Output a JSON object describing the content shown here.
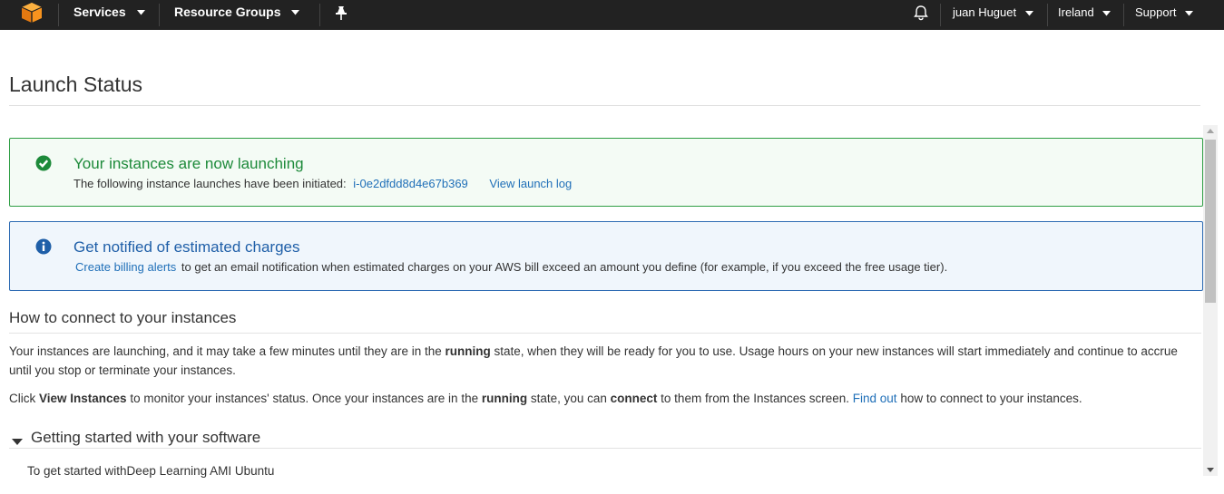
{
  "nav": {
    "services": "Services",
    "resource_groups": "Resource Groups",
    "user": "juan Huguet",
    "region": "Ireland",
    "support": "Support"
  },
  "page": {
    "title": "Launch Status"
  },
  "alerts": {
    "success": {
      "title": "Your instances are now launching",
      "text": "The following instance launches have been initiated:",
      "instance_id": "i-0e2dfdd8d4e67b369",
      "log_link": "View launch log"
    },
    "billing": {
      "title": "Get notified of estimated charges",
      "link": "Create billing alerts",
      "text": "to get an email notification when estimated charges on your AWS bill exceed an amount you define (for example, if you exceed the free usage tier)."
    }
  },
  "connect": {
    "title": "How to connect to your instances",
    "p1_a": "Your instances are launching, and it may take a few minutes until they are in the ",
    "p1_b": "running",
    "p1_c": " state, when they will be ready for you to use. Usage hours on your new instances will start immediately and continue to accrue until you stop or terminate your instances.",
    "p2_a": "Click ",
    "p2_b": "View Instances",
    "p2_c": " to monitor your instances' status. Once your instances are in the ",
    "p2_d": "running",
    "p2_e": " state, you can ",
    "p2_f": "connect",
    "p2_g": " to them from the Instances screen. ",
    "p2_link": "Find out",
    "p2_h": " how to connect to your instances."
  },
  "software": {
    "title": "Getting started with your software",
    "text": "To get started withDeep Learning AMI Ubuntu"
  },
  "colors": {
    "nav_bg": "#222222",
    "success": "#1d8a3a",
    "link": "#1f6fb8",
    "aws_orange": "#f7931e"
  },
  "icons": [
    "aws-cube-icon",
    "pin-icon",
    "bell-icon",
    "check-circle-icon",
    "info-circle-icon",
    "caret-down-icon"
  ]
}
